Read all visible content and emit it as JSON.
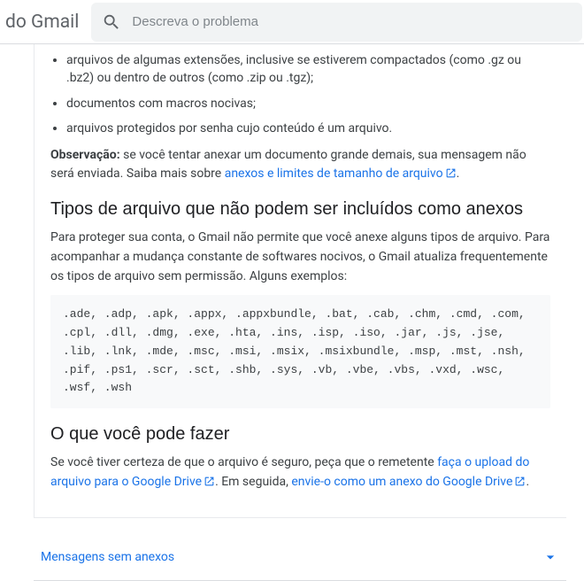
{
  "header": {
    "product_label": "do Gmail",
    "search_placeholder": "Descreva o problema"
  },
  "article": {
    "bullets": [
      "arquivos de algumas extensões, inclusive se estiverem compactados (como .gz ou .bz2) ou dentro de outros (como .zip ou .tgz);",
      "documentos com macros nocivas;",
      "arquivos protegidos por senha cujo conteúdo é um arquivo."
    ],
    "note_label": "Observação:",
    "note_body_pre": " se você tentar anexar um documento grande demais, sua mensagem não será enviada. Saiba mais sobre ",
    "note_link": "anexos e limites de tamanho de arquivo",
    "note_body_post": ".",
    "section1_title": "Tipos de arquivo que não podem ser incluídos como anexos",
    "section1_para": "Para proteger sua conta, o Gmail não permite que você anexe alguns tipos de arquivo. Para acompanhar a mudança constante de softwares nocivos, o Gmail atualiza frequentemente os tipos de arquivo sem permissão. Alguns exemplos:",
    "blocked_ext": ".ade, .adp, .apk, .appx, .appxbundle, .bat, .cab, .chm, .cmd, .com, .cpl, .dll, .dmg, .exe, .hta, .ins, .isp, .iso, .jar, .js, .jse, .lib, .lnk, .mde, .msc, .msi, .msix, .msixbundle, .msp, .mst, .nsh, .pif, .ps1, .scr, .sct, .shb, .sys, .vb, .vbe, .vbs, .vxd, .wsc, .wsf, .wsh",
    "section2_title": "O que você pode fazer",
    "section2_pre": "Se você tiver certeza de que o arquivo é seguro, peça que o remetente ",
    "section2_link1": "faça o upload do arquivo para o Google Drive",
    "section2_mid": ". Em seguida, ",
    "section2_link2": "envie-o como um anexo do Google Drive",
    "section2_post": "."
  },
  "accordion": {
    "label": "Mensagens sem anexos"
  }
}
